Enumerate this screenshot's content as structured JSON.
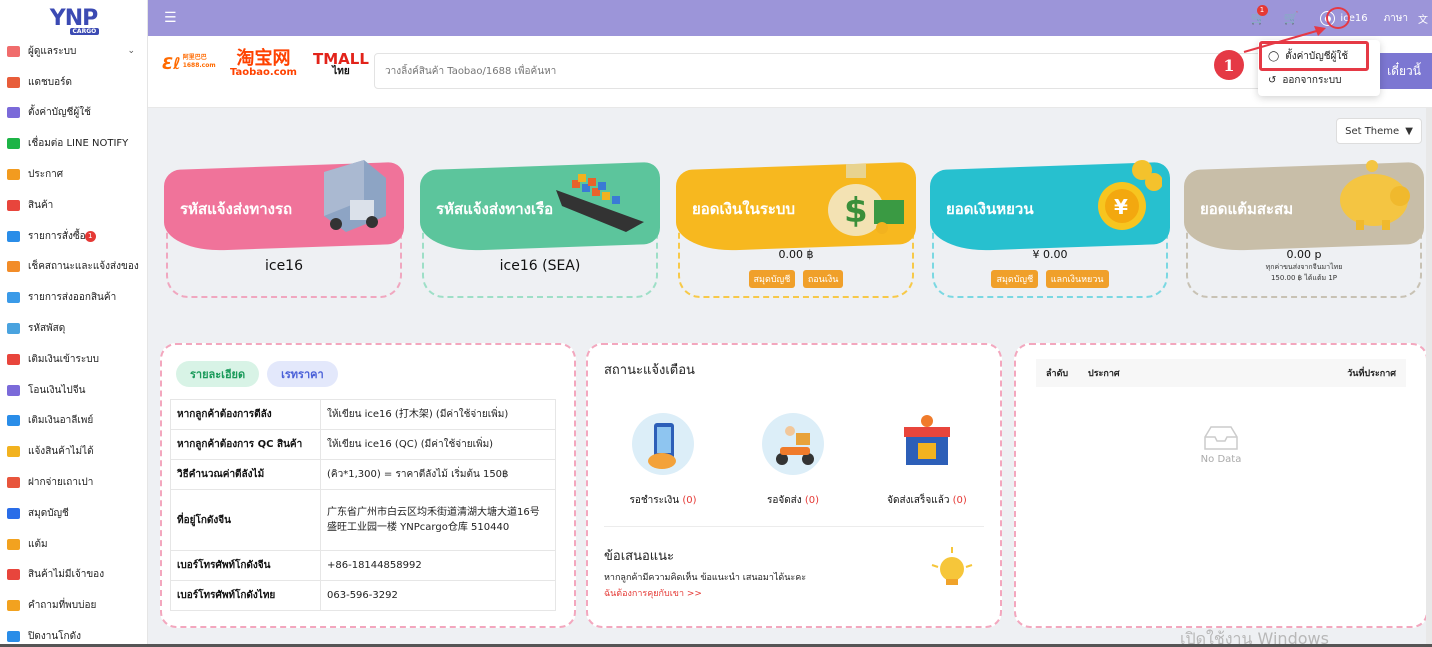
{
  "logo": {
    "text": "YNP",
    "sub": "CARGO"
  },
  "sidebar": {
    "items": [
      {
        "label": "ผู้ดูแลระบบ",
        "icon": "admin-icon",
        "color": "#f06c6c",
        "chevron": "⌄"
      },
      {
        "label": "แดชบอร์ด",
        "icon": "dashboard-icon",
        "color": "#e85d3a"
      },
      {
        "label": "ตั้งค่าบัญชีผู้ใช้",
        "icon": "user-settings-icon",
        "color": "#7b6ad9"
      },
      {
        "label": "เชื่อมต่อ LINE NOTIFY",
        "icon": "line-icon",
        "color": "#1db447"
      },
      {
        "label": "ประกาศ",
        "icon": "announce-icon",
        "color": "#f29b1f"
      },
      {
        "label": "สินค้า",
        "icon": "product-icon",
        "color": "#e8453c"
      },
      {
        "label": "รายการสั่งซื้อ",
        "icon": "orders-icon",
        "color": "#2a8de8",
        "badge": "1"
      },
      {
        "label": "เช็คสถานะและแจ้งส่งของ",
        "icon": "truck-icon",
        "color": "#f28c28"
      },
      {
        "label": "รายการส่งออกสินค้า",
        "icon": "export-icon",
        "color": "#3a9ae8"
      },
      {
        "label": "รหัสพัสดุ",
        "icon": "parcel-icon",
        "color": "#4aa3df"
      },
      {
        "label": "เติมเงินเข้าระบบ",
        "icon": "topup-icon",
        "color": "#e8453c"
      },
      {
        "label": "โอนเงินไปจีน",
        "icon": "transfer-icon",
        "color": "#7b6ad9"
      },
      {
        "label": "เติมเงินอาลีเพย์",
        "icon": "alipay-icon",
        "color": "#2a8de8"
      },
      {
        "label": "แจ้งสินค้าไม่ได้",
        "icon": "report-icon",
        "color": "#f2b21f"
      },
      {
        "label": "ฝากจ่ายเถาเปา",
        "icon": "taobao-pay-icon",
        "color": "#e8553c"
      },
      {
        "label": "สมุดบัญชี",
        "icon": "book-icon",
        "color": "#2a6de8"
      },
      {
        "label": "แต้ม",
        "icon": "points-icon",
        "color": "#f2a21f"
      },
      {
        "label": "สินค้าไม่มีเจ้าของ",
        "icon": "ownerless-icon",
        "color": "#e8453c"
      },
      {
        "label": "คำถามที่พบบ่อย",
        "icon": "faq-icon",
        "color": "#f2a21f"
      },
      {
        "label": "ปิดงานโกดัง",
        "icon": "warehouse-icon",
        "color": "#2a8de8"
      }
    ]
  },
  "header": {
    "menu_icon": "☰",
    "cart_badge": "1",
    "username": "ice16",
    "language": "ภาษา",
    "language_icon": "文"
  },
  "search": {
    "brand_1": "淘宝网",
    "brand_1_en": "Taobao.com",
    "brand_2": "TMALL",
    "brand_2_sub": "ไทย",
    "placeholder": "วางลิ้งค์สินค้า Taobao/1688 เพื่อค้นหา",
    "button": "เดี๋ยวนี้"
  },
  "dropdown": {
    "item_1": "ตั้งค่าบัญชีผู้ใช้",
    "item_2": "ออกจากระบบ",
    "step": "1"
  },
  "theme_button": "Set Theme",
  "cards": [
    {
      "title": "รหัสแจ้งส่งทางรถ",
      "value": "ice16",
      "color": "#f0739a",
      "frame": "#f0a7bf"
    },
    {
      "title": "รหัสแจ้งส่งทางเรือ",
      "value": "ice16 (SEA)",
      "color": "#5cc59c",
      "frame": "#9edfc7"
    },
    {
      "title": "ยอดเงินในระบบ",
      "value": "0.00 ฿",
      "color": "#f7b81f",
      "frame": "#f7c948",
      "btn1": "สมุดบัญชี",
      "btn2": "ถอนเงิน"
    },
    {
      "title": "ยอดเงินหยวน",
      "value": "¥ 0.00",
      "color": "#27c0cf",
      "frame": "#7bd8e2",
      "btn1": "สมุดบัญชี",
      "btn2": "แลกเงินหยวน"
    },
    {
      "title": "ยอดแต้มสะสม",
      "value": "0.00 p",
      "color": "#c8bea8",
      "frame": "#c8c2b4",
      "note1": "ทุกค่าขนส่งจากจีนมาไทย",
      "note2": "150.00 ฿ ได้แต้ม 1P"
    }
  ],
  "details": {
    "tab_1": "รายละเอียด",
    "tab_2": "เรทราคา",
    "rows": [
      {
        "k": "หากลูกค้าต้องการตีลัง",
        "v": "ให้เขียน ice16 (打木架) (มีค่าใช้จ่ายเพิ่ม)"
      },
      {
        "k": "หากลูกค้าต้องการ QC สินค้า",
        "v": "ให้เขียน ice16 (QC) (มีค่าใช้จ่ายเพิ่ม)"
      },
      {
        "k": "วิธีคำนวณค่าตีลังไม้",
        "v": "(คิว*1,300) = ราคาตีลังไม้ เริ่มต้น 150฿"
      },
      {
        "k": "ที่อยู่โกดังจีน",
        "v": "广东省广州市白云区均禾街道清湖大塘大道16号盛旺工业园一楼 YNPcargo仓库 510440"
      },
      {
        "k": "เบอร์โทรศัพท์โกดังจีน",
        "v": "+86-18144858992"
      },
      {
        "k": "เบอร์โทรศัพท์โกดังไทย",
        "v": "063-596-3292"
      }
    ]
  },
  "notifications": {
    "title": "สถานะแจ้งเตือน",
    "s1_label": "รอชำระเงิน",
    "s1_count": "(0)",
    "s2_label": "รอจัดส่ง",
    "s2_count": "(0)",
    "s3_label": "จัดส่งเสร็จแล้ว",
    "s3_count": "(0)",
    "suggest_title": "ข้อเสนอแนะ",
    "suggest_text": "หากลูกค้ามีความคิดเห็น ข้อแนะนำ เสนอมาได้นะคะ",
    "suggest_link": "ฉันต้องการคุยกับเขา >>"
  },
  "announcements": {
    "col_1": "ลำดับ",
    "col_2": "ประกาศ",
    "col_3": "วันที่ประกาศ",
    "empty": "No Data"
  },
  "watermark": "เปิดใช้งาน Windows"
}
